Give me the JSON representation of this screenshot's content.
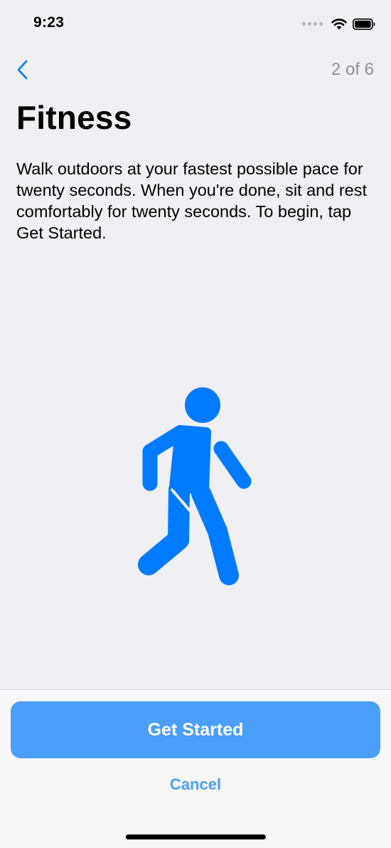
{
  "status_bar": {
    "time": "9:23",
    "icons": [
      "signal-icon",
      "wifi-icon",
      "battery-icon"
    ]
  },
  "nav": {
    "back_icon": "chevron-left-icon",
    "step_counter": "2 of 6"
  },
  "content": {
    "title": "Fitness",
    "instructions": "Walk outdoors at your fastest possible pace for twenty seconds. When you're done, sit and rest comfortably for twenty seconds. To begin, tap Get Started.",
    "illustration_icon": "walking-person-icon"
  },
  "footer": {
    "primary_label": "Get Started",
    "secondary_label": "Cancel"
  },
  "colors": {
    "accent": "#007aff",
    "button_fill": "#4b9efa",
    "background": "#efeff4",
    "footer_background": "#f7f7f7",
    "muted_text": "#8e8e93"
  }
}
